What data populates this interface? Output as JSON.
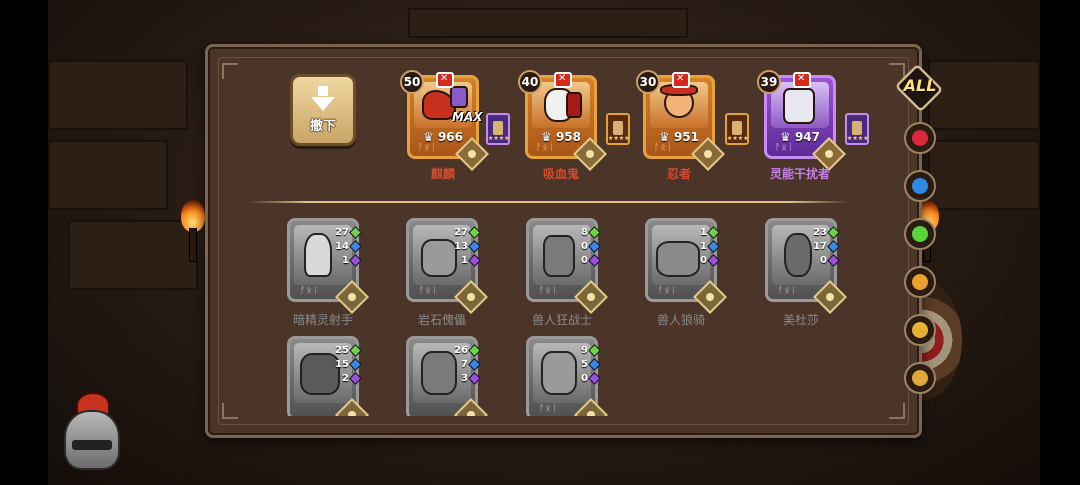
{
  "withdraw_button": {
    "label": "撤下"
  },
  "max_label": "MAX",
  "top_heroes": [
    {
      "name": "麒麟",
      "level": "50",
      "power": "966",
      "rarity": "orange",
      "rune": "ᚨᛟᛁ"
    },
    {
      "name": "吸血鬼",
      "level": "40",
      "power": "958",
      "rarity": "orange",
      "rune": "ᚨᛟᛁ"
    },
    {
      "name": "忍者",
      "level": "30",
      "power": "951",
      "rarity": "orange",
      "rune": "ᚨᛟᛁ"
    },
    {
      "name": "灵能干扰者",
      "level": "39",
      "power": "947",
      "rarity": "purple",
      "rune": "ᚨᛟᛁ"
    }
  ],
  "bottom_heroes": [
    {
      "name": "暗精灵射手",
      "green": "27",
      "blue": "14",
      "purple": "1",
      "rune": "ᚨᛟᛁ"
    },
    {
      "name": "岩石傀儡",
      "green": "27",
      "blue": "13",
      "purple": "1",
      "rune": "ᚨᛟᛁ"
    },
    {
      "name": "兽人狂战士",
      "green": "8",
      "blue": "0",
      "purple": "0",
      "rune": "ᚨᛟᛁ"
    },
    {
      "name": "兽人狼骑",
      "green": "1",
      "blue": "1",
      "purple": "0",
      "rune": "ᚨᛟᛁ"
    },
    {
      "name": "美杜莎",
      "green": "23",
      "blue": "17",
      "purple": "0",
      "rune": "ᚨᛟᛁ"
    },
    {
      "name": "",
      "green": "25",
      "blue": "15",
      "purple": "2",
      "rune": ""
    },
    {
      "name": "",
      "green": "26",
      "blue": "7",
      "purple": "3",
      "rune": ""
    },
    {
      "name": "",
      "green": "9",
      "blue": "5",
      "purple": "0",
      "rune": "ᚨᛟᛁ"
    }
  ],
  "filters": {
    "all_label": "ALL",
    "items": [
      {
        "icon": "red-flame-icon",
        "color": "#d8283a"
      },
      {
        "icon": "blue-orb-icon",
        "color": "#2f8ae6"
      },
      {
        "icon": "green-leaf-icon",
        "color": "#5bd43a"
      },
      {
        "icon": "gold-helmet-icon",
        "color": "#e8a02a"
      },
      {
        "icon": "gold-emblem-icon",
        "color": "#e8b030"
      },
      {
        "icon": "gold-scroll-icon",
        "color": "#e0a838"
      }
    ]
  }
}
